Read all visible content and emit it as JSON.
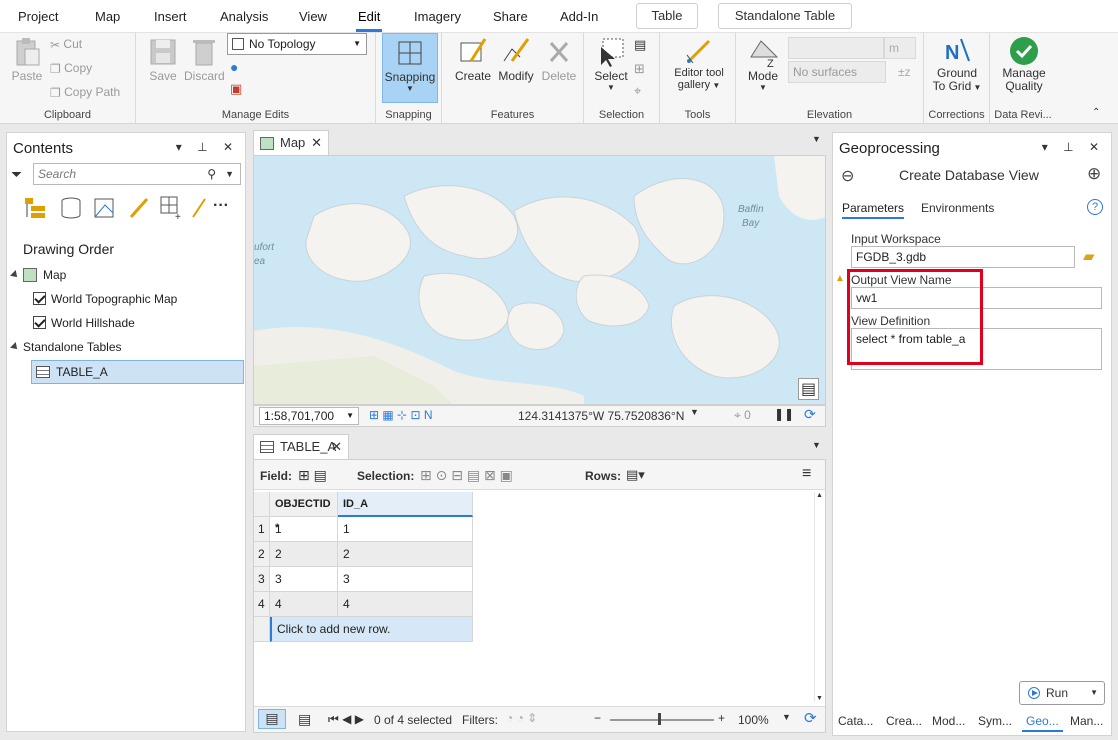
{
  "menu": {
    "tabs": [
      "Project",
      "Map",
      "Insert",
      "Analysis",
      "View",
      "Edit",
      "Imagery",
      "Share",
      "Add-In"
    ],
    "active": "Edit",
    "context_tabs": [
      "Table",
      "Standalone Table"
    ]
  },
  "ribbon": {
    "clipboard": {
      "paste": "Paste",
      "cut": "Cut",
      "copy": "Copy",
      "copy_path": "Copy Path",
      "label": "Clipboard"
    },
    "manage_edits": {
      "save": "Save",
      "discard": "Discard",
      "topology_value": "No Topology",
      "label": "Manage Edits"
    },
    "snapping": {
      "button": "Snapping",
      "label": "Snapping"
    },
    "features": {
      "create": "Create",
      "modify": "Modify",
      "delete": "Delete",
      "label": "Features"
    },
    "selection": {
      "select": "Select",
      "label": "Selection"
    },
    "tools": {
      "gallery_line1": "Editor tool",
      "gallery_line2": "gallery",
      "label": "Tools"
    },
    "elevation": {
      "mode": "Mode",
      "surface_placeholder": "No surfaces",
      "units": "m",
      "label": "Elevation"
    },
    "corrections": {
      "line1": "Ground",
      "line2": "To Grid",
      "label": "Corrections"
    },
    "data_review": {
      "line1": "Manage",
      "line2": "Quality",
      "label": "Data Revi..."
    }
  },
  "contents": {
    "title": "Contents",
    "search_placeholder": "Search",
    "drawing_order": "Drawing Order",
    "map": "Map",
    "layers": [
      "World Topographic Map",
      "World Hillshade"
    ],
    "standalone": "Standalone Tables",
    "table": "TABLE_A"
  },
  "map_view": {
    "tab": "Map",
    "labels": {
      "baffin": "Baffin",
      "bay": "Bay",
      "beaufort": "ufort",
      "sea": "ea"
    },
    "scale": "1:58,701,700",
    "coords": "124.3141375°W 75.7520836°N",
    "selection_count": "0"
  },
  "table_view": {
    "tab": "TABLE_A",
    "field_label": "Field:",
    "selection_label": "Selection:",
    "rows_label": "Rows:",
    "columns": [
      "OBJECTID *",
      "ID_A"
    ],
    "rows": [
      {
        "n": "1",
        "objectid": "1",
        "id_a": "1"
      },
      {
        "n": "2",
        "objectid": "2",
        "id_a": "2"
      },
      {
        "n": "3",
        "objectid": "3",
        "id_a": "3"
      },
      {
        "n": "4",
        "objectid": "4",
        "id_a": "4"
      }
    ],
    "add_row": "Click to add new row.",
    "status": "0 of 4 selected",
    "filters": "Filters:",
    "zoom": "100%"
  },
  "geoprocessing": {
    "title": "Geoprocessing",
    "tool": "Create Database View",
    "tabs": [
      "Parameters",
      "Environments"
    ],
    "input_workspace_label": "Input Workspace",
    "input_workspace_value": "FGDB_3.gdb",
    "output_view_label": "Output View Name",
    "output_view_value": "vw1",
    "view_def_label": "View Definition",
    "view_def_value": "select * from table_a",
    "run": "Run",
    "bottom_tabs": [
      "Cata...",
      "Crea...",
      "Mod...",
      "Sym...",
      "Geo...",
      "Man..."
    ]
  },
  "colors": {
    "accent": "#2b7bd6",
    "highlight": "#e0001b",
    "selected_row": "#cde3f5",
    "snapping_bg": "#a9d3f5"
  }
}
